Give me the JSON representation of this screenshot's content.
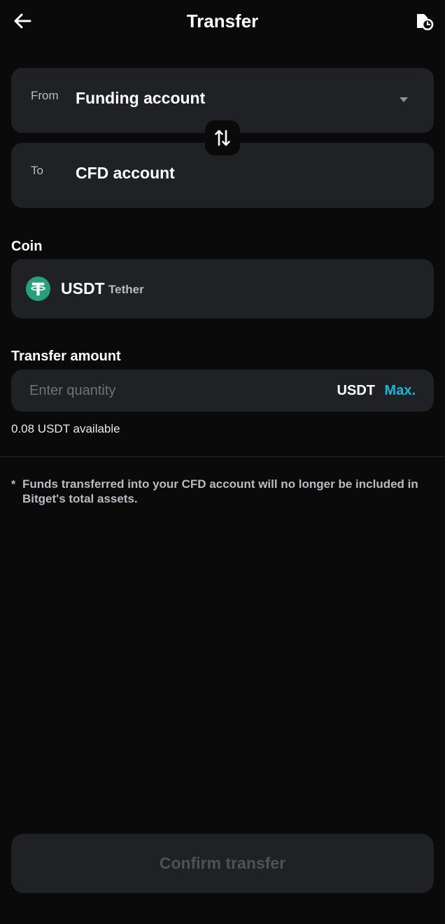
{
  "header": {
    "title": "Transfer",
    "back_icon": "arrow-left-icon",
    "history_icon": "transfer-history-icon"
  },
  "from": {
    "label": "From",
    "value": "Funding account"
  },
  "to": {
    "label": "To",
    "value": "CFD account"
  },
  "swap_icon": "swap-vertical-icon",
  "coin": {
    "section_label": "Coin",
    "symbol": "USDT",
    "name": "Tether",
    "icon": "tether-icon",
    "icon_color": "#26a17b"
  },
  "amount": {
    "section_label": "Transfer amount",
    "placeholder": "Enter quantity",
    "value": "",
    "unit": "USDT",
    "max_label": "Max.",
    "available_text": "0.08 USDT available"
  },
  "note": {
    "marker": "*",
    "text": "Funds transferred into your CFD account will no longer be included in Bitget's total assets."
  },
  "confirm_button": {
    "label": "Confirm transfer",
    "enabled": false
  },
  "colors": {
    "background": "#0a0a0b",
    "card": "#202124",
    "accent": "#16b6d7",
    "muted_text": "#b9bbc1",
    "disabled_text": "#4e5157"
  }
}
